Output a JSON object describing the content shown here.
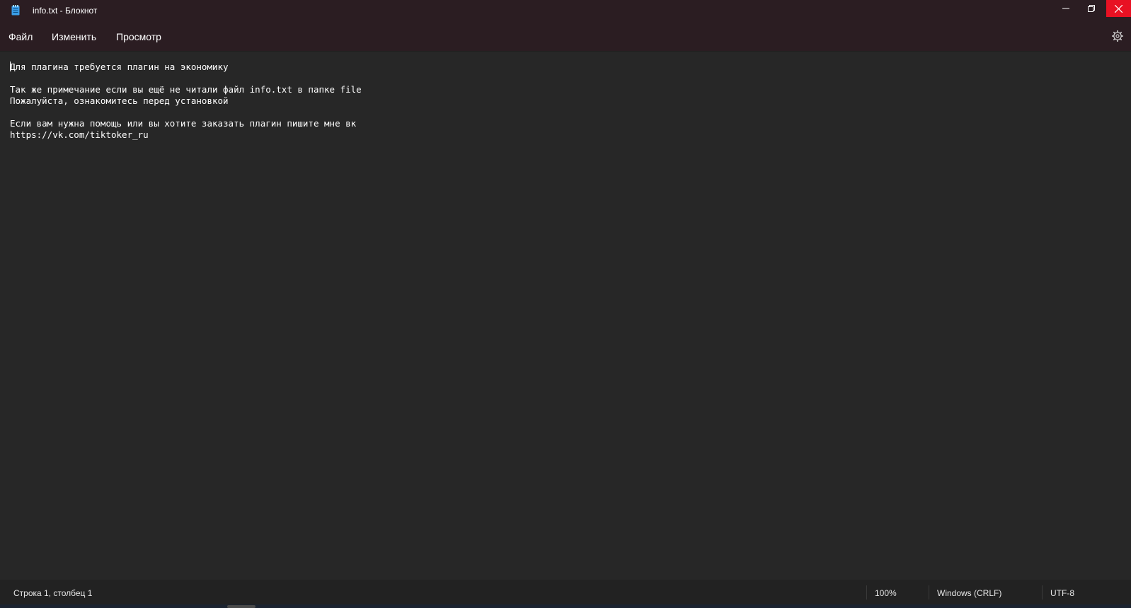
{
  "window": {
    "title": "info.txt - Блокнот"
  },
  "menu": {
    "file": "Файл",
    "edit": "Изменить",
    "view": "Просмотр"
  },
  "editor": {
    "lines": [
      "Для плагина требуется плагин на экономику",
      "",
      "Так же примечание если вы ещё не читали файл info.txt в папке file",
      "Пожалуйста, ознакомитесь перед установкой",
      "",
      "Если вам нужна помощь или вы хотите заказать плагин пишите мне вк",
      "https://vk.com/tiktoker_ru"
    ]
  },
  "status": {
    "position": "Строка 1, столбец 1",
    "zoom": "100%",
    "line_ending": "Windows (CRLF)",
    "encoding": "UTF-8"
  },
  "icons": {
    "app": "notepad-icon",
    "minimize": "minimize-icon",
    "maximize": "restore-icon",
    "close": "close-icon",
    "settings": "gear-icon"
  },
  "colors": {
    "titlebar": "#2b1d22",
    "editor_bg": "#272727",
    "close_button": "#e81123"
  }
}
